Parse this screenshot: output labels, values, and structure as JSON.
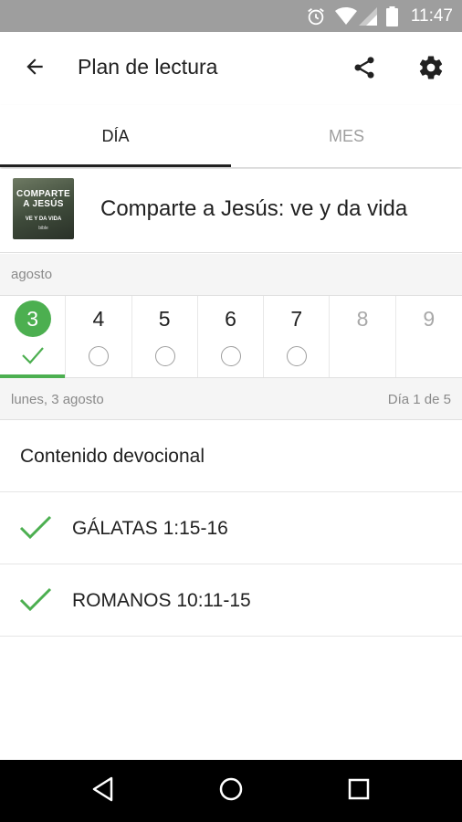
{
  "status_bar": {
    "time": "11:47",
    "icons": [
      "alarm-icon",
      "wifi-icon",
      "signal-icon",
      "battery-icon"
    ]
  },
  "app_bar": {
    "title": "Plan de lectura",
    "icons": [
      "back-arrow-icon",
      "share-icon",
      "gear-icon"
    ]
  },
  "tabs": [
    {
      "label": "DÍA",
      "active": true
    },
    {
      "label": "MES",
      "active": false
    }
  ],
  "plan": {
    "title": "Comparte a Jesús: ve y da vida",
    "thumbnail": {
      "line1": "COMPARTE",
      "line2": "A JESÚS",
      "line3": "VE Y DA VIDA",
      "line4": "bible"
    }
  },
  "calendar": {
    "month": "agosto",
    "days": [
      {
        "num": "3",
        "state": "selected-complete"
      },
      {
        "num": "4",
        "state": "pending"
      },
      {
        "num": "5",
        "state": "pending"
      },
      {
        "num": "6",
        "state": "pending"
      },
      {
        "num": "7",
        "state": "pending"
      },
      {
        "num": "8",
        "state": "future"
      },
      {
        "num": "9",
        "state": "future"
      }
    ]
  },
  "date_info": {
    "date": "lunes, 3 agosto",
    "progress": "Día 1 de 5"
  },
  "content": {
    "devotional_label": "Contenido devocional",
    "readings": [
      {
        "label": "GÁLATAS 1:15-16",
        "completed": true
      },
      {
        "label": "ROMANOS 10:11-15",
        "completed": true
      }
    ]
  },
  "colors": {
    "accent": "#4caf50",
    "status_bar": "#9e9e9e",
    "nav_bar": "#000000"
  },
  "nav_bar": {
    "icons": [
      "back-triangle-icon",
      "home-circle-icon",
      "recents-square-icon"
    ]
  }
}
